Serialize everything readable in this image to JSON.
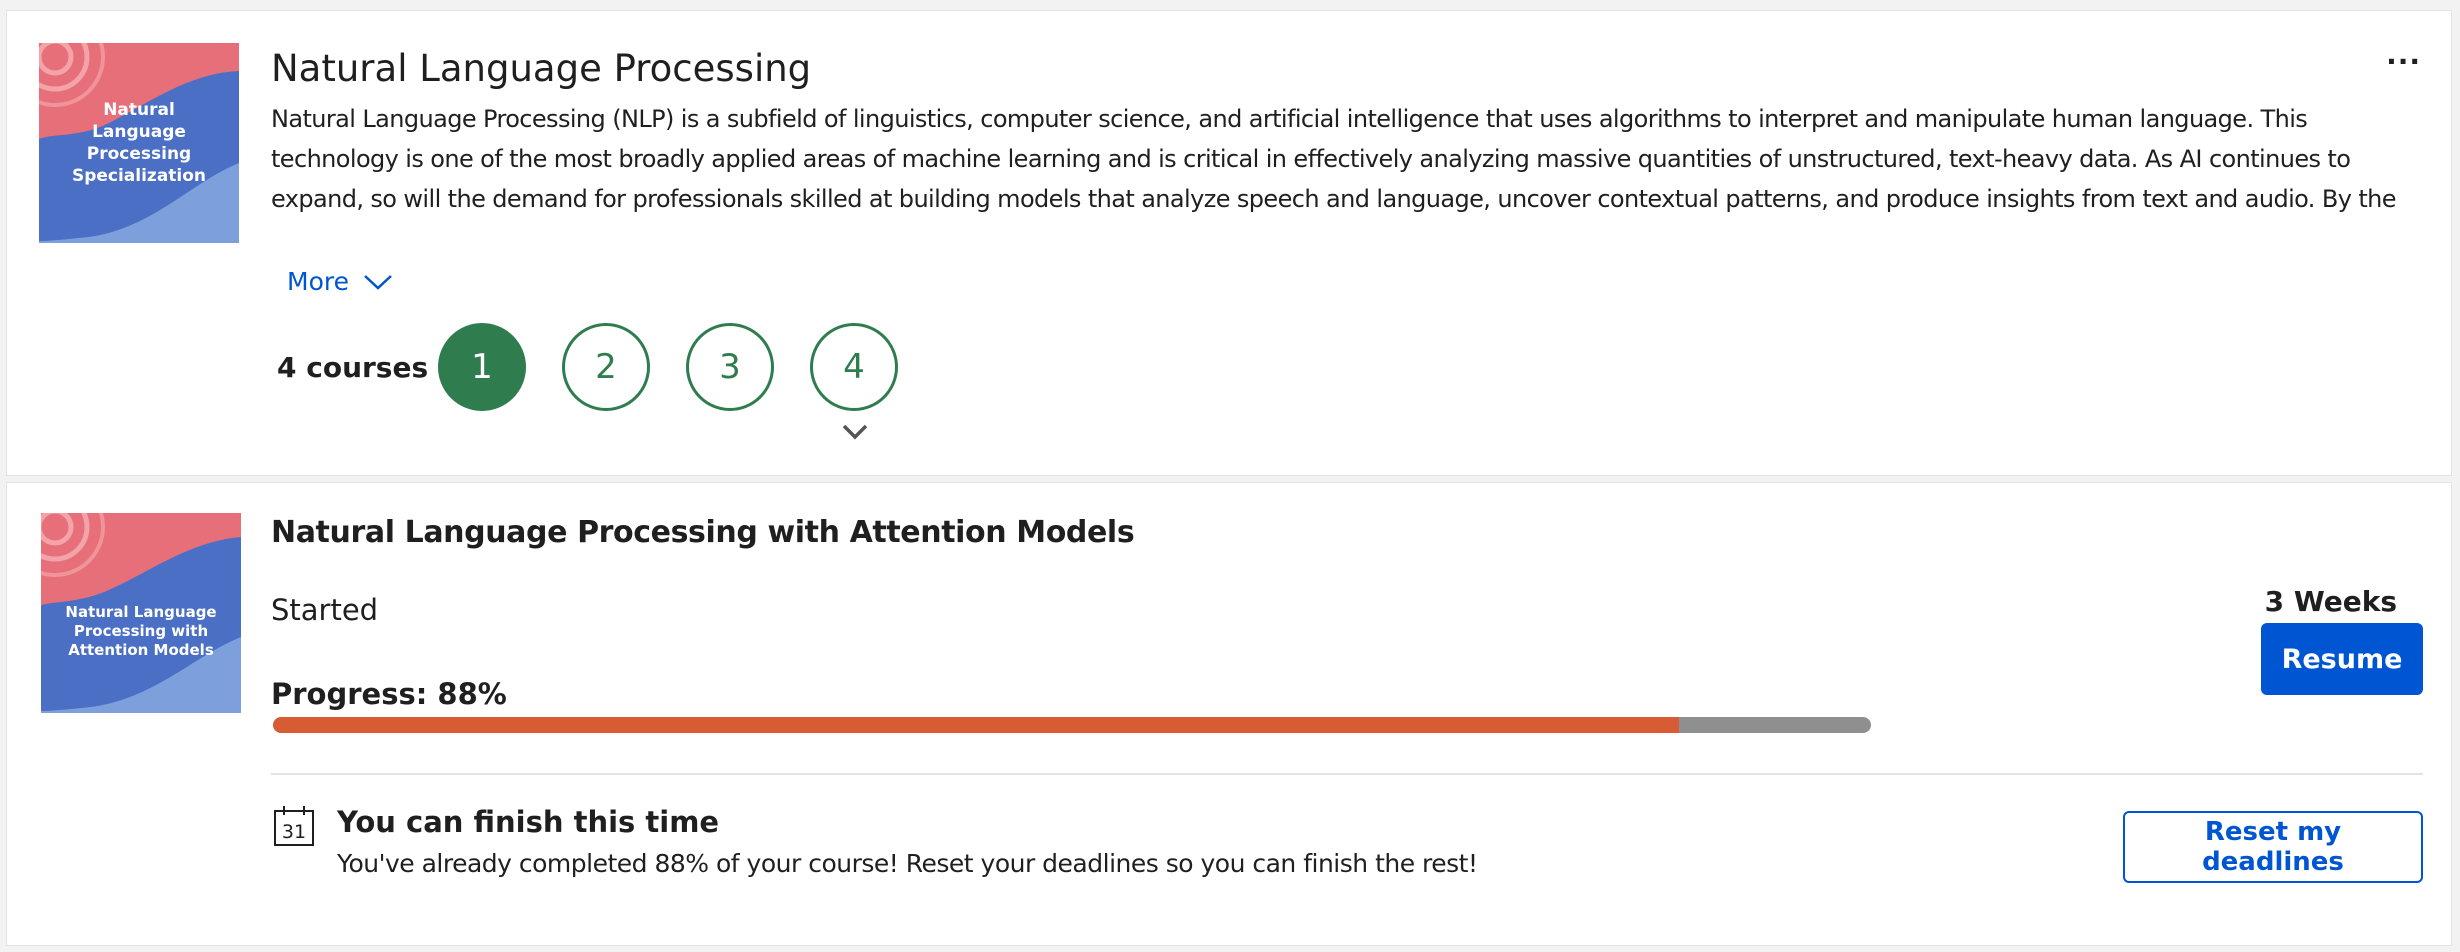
{
  "specialization": {
    "title": "Natural Language Processing",
    "description": "Natural Language Processing (NLP) is a subfield of linguistics, computer science, and artificial intelligence that uses algorithms to interpret and manipulate human language. This technology is one of the most broadly applied areas of machine learning and is critical in effectively analyzing massive quantities of unstructured, text-heavy data. As AI continues to expand, so will the demand for professionals skilled at building models that analyze speech and language, uncover contextual patterns, and produce insights from text and audio. By the",
    "thumbnail_text": [
      "Natural",
      "Language",
      "Processing",
      "Specialization"
    ],
    "more_label": "More",
    "menu_label": "...",
    "courses_count": "4 courses",
    "course_numbers": [
      "1",
      "2",
      "3",
      "4"
    ],
    "active_course": "1"
  },
  "course": {
    "title": "Natural Language Processing with Attention Models",
    "thumbnail_text": [
      "Natural Language",
      "Processing with",
      "Attention Models"
    ],
    "status": "Started",
    "progress_label": "Progress: 88%",
    "progress_value": 0.88,
    "duration": "3 Weeks",
    "resume_label": "Resume"
  },
  "deadline": {
    "calendar_day": "31",
    "title": "You can finish this time",
    "text": "You've already completed 88% of your course! Reset your deadlines so you can finish the rest!",
    "reset_label": "Reset my deadlines"
  },
  "colors": {
    "accent": "#0056d2",
    "course_green": "#2f7d4e",
    "progress_fill": "#d75c33",
    "progress_track": "#8f8f8f",
    "thumb_blue": "#4a6fc4",
    "thumb_pink": "#e76f7a"
  },
  "icons": {
    "more": "chevron-down-icon",
    "expand": "chevron-down-icon",
    "calendar": "calendar-icon",
    "menu": "ellipsis-icon"
  }
}
